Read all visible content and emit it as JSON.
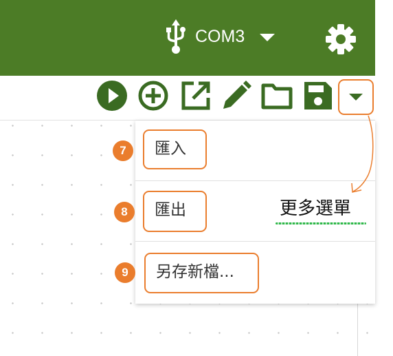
{
  "header": {
    "port": {
      "label": "COM3",
      "icon": "usb-icon"
    },
    "settings_icon": "gear-icon",
    "bg_color": "#4c7c26"
  },
  "toolbar": {
    "buttons": [
      {
        "name": "run-button",
        "icon": "play-icon"
      },
      {
        "name": "add-button",
        "icon": "plus-circle-icon"
      },
      {
        "name": "open-external-button",
        "icon": "open-in-new-icon"
      },
      {
        "name": "edit-button",
        "icon": "pencil-icon"
      },
      {
        "name": "open-folder-button",
        "icon": "folder-icon"
      },
      {
        "name": "save-button",
        "icon": "floppy-disk-icon"
      },
      {
        "name": "more-menu-button",
        "icon": "caret-down-icon"
      }
    ],
    "icon_color": "#3a6b22"
  },
  "menu": {
    "items": [
      {
        "label": "匯入",
        "badge": "7"
      },
      {
        "label": "匯出",
        "badge": "8"
      },
      {
        "label": "另存新檔...",
        "badge": "9"
      }
    ]
  },
  "annotation": {
    "label": "更多選單",
    "highlight_color": "#ea7d2d"
  }
}
